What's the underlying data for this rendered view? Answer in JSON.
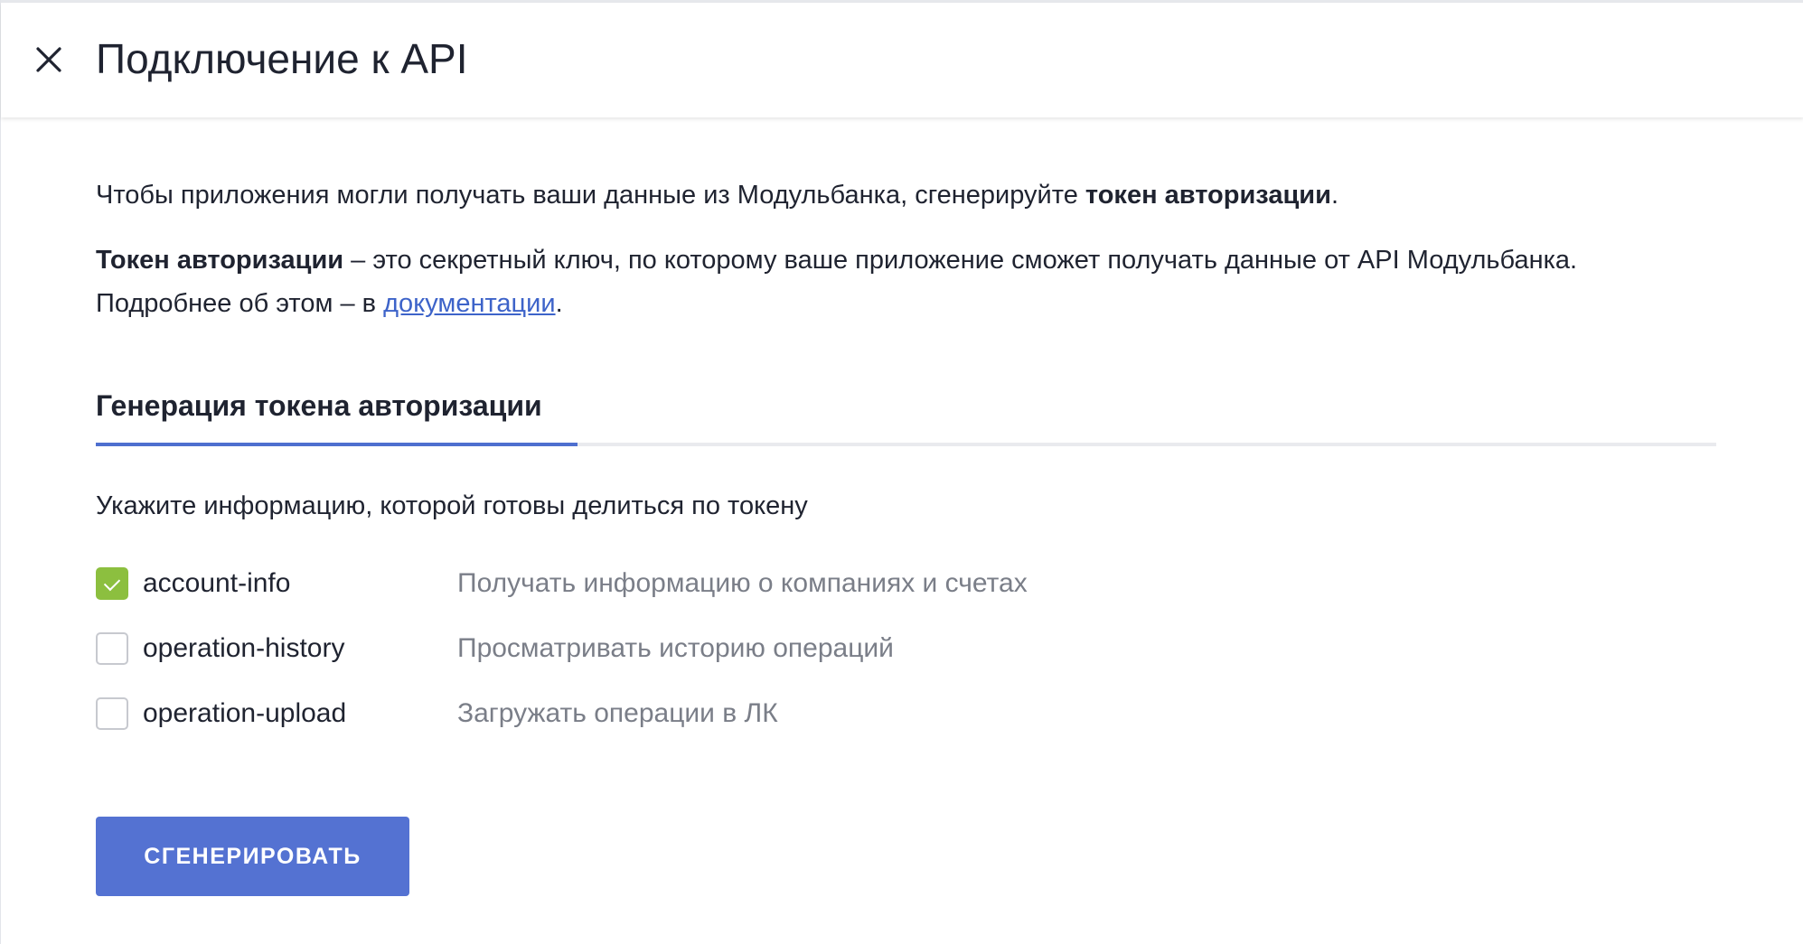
{
  "header": {
    "title": "Подключение к API",
    "close_icon": "close-icon"
  },
  "intro": {
    "line1_before": "Чтобы приложения могли получать ваши данные из Модульбанка, сгенерируйте ",
    "line1_bold": "токен авторизации",
    "line1_after": ".",
    "line2_bold": "Токен авторизации",
    "line2_before_link": " – это секретный ключ, по которому ваше приложение сможет получать данные от API Модульбанка. Подробнее об этом – в ",
    "line2_link": "документации",
    "line2_after_link": "."
  },
  "tabs": [
    {
      "label": "Генерация токена авторизации",
      "active": true
    }
  ],
  "scopes_prompt": "Укажите информацию, которой готовы делиться по токену",
  "scopes": [
    {
      "name": "account-info",
      "description": "Получать информацию о компаниях и счетах",
      "checked": true
    },
    {
      "name": "operation-history",
      "description": "Просматривать историю операций",
      "checked": false
    },
    {
      "name": "operation-upload",
      "description": "Загружать операции в ЛК",
      "checked": false
    }
  ],
  "generate_button": {
    "label": "СГЕНЕРИРОВАТЬ"
  },
  "colors": {
    "accent": "#5472d2",
    "link": "#3d63c9",
    "checkbox_checked": "#8cbf3f",
    "text": "#1f2330",
    "muted_text": "#7a7e88"
  }
}
